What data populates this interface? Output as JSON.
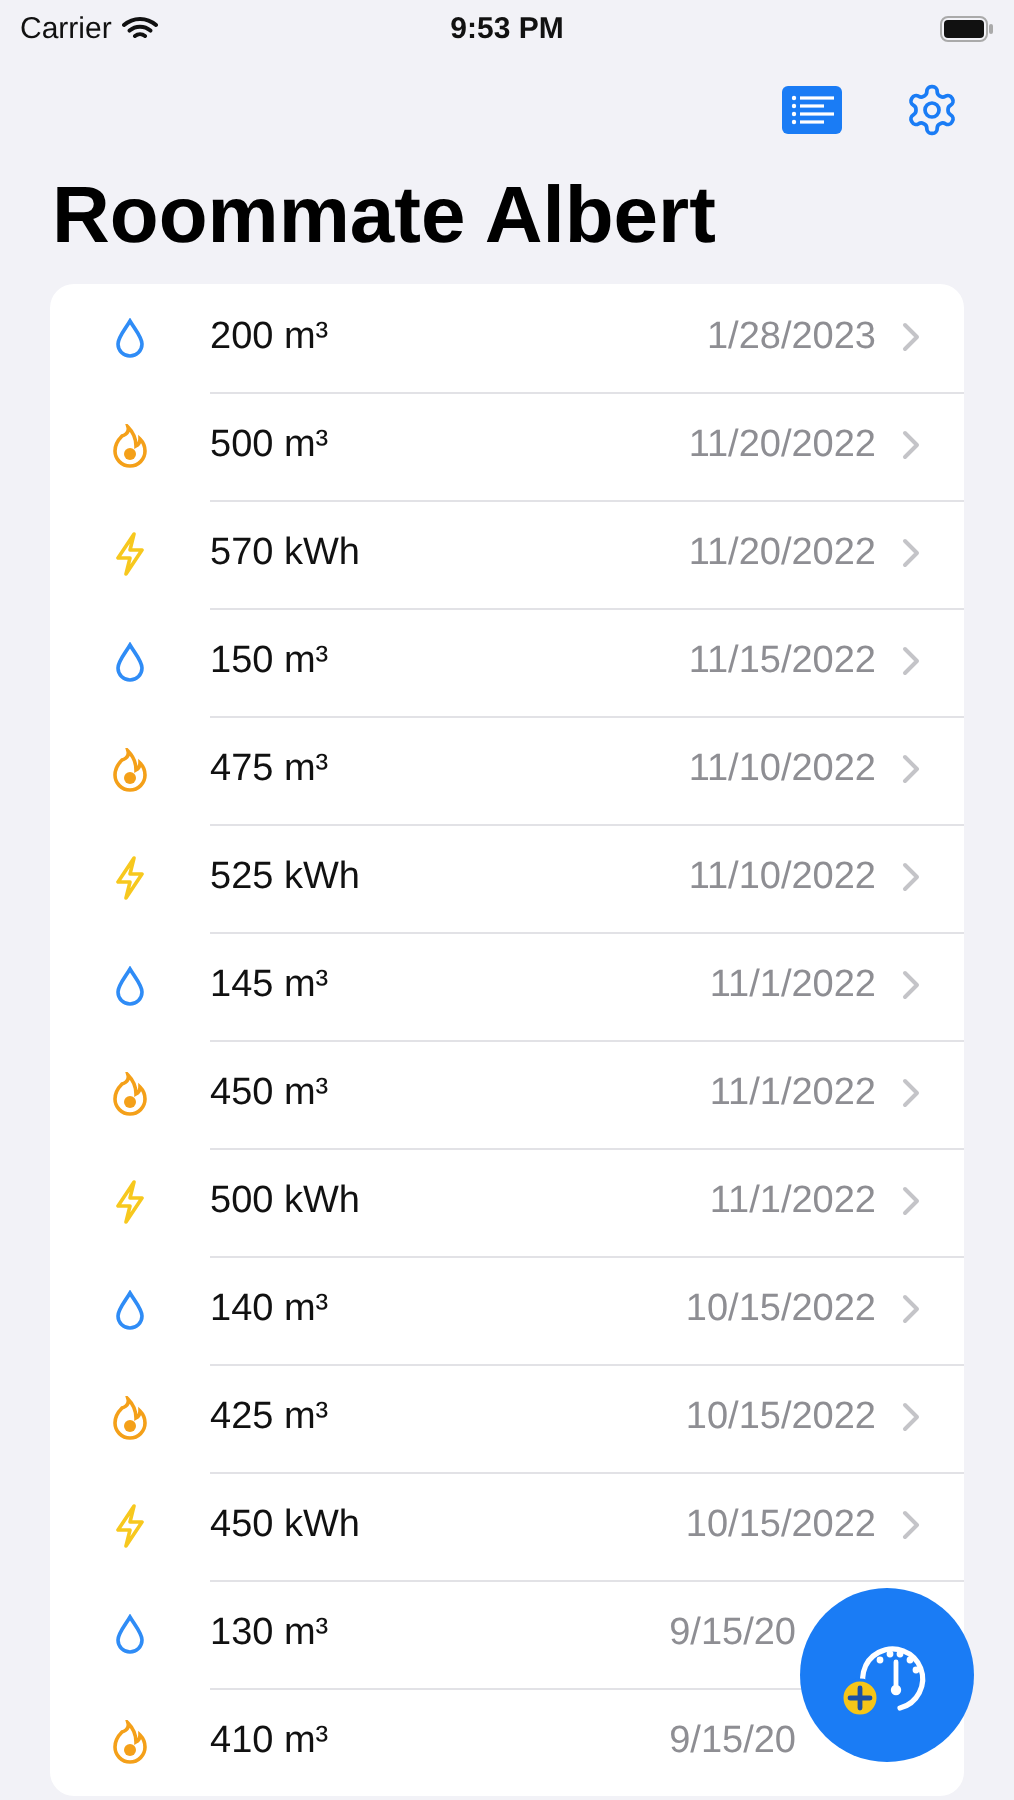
{
  "status_bar": {
    "carrier": "Carrier",
    "time": "9:53 PM"
  },
  "nav": {
    "title": "Roommate Albert"
  },
  "readings": [
    {
      "kind": "water",
      "value": "200 m³",
      "date": "1/28/2023",
      "chevron": true
    },
    {
      "kind": "gas",
      "value": "500 m³",
      "date": "11/20/2022",
      "chevron": true
    },
    {
      "kind": "power",
      "value": "570 kWh",
      "date": "11/20/2022",
      "chevron": true
    },
    {
      "kind": "water",
      "value": "150 m³",
      "date": "11/15/2022",
      "chevron": true
    },
    {
      "kind": "gas",
      "value": "475 m³",
      "date": "11/10/2022",
      "chevron": true
    },
    {
      "kind": "power",
      "value": "525 kWh",
      "date": "11/10/2022",
      "chevron": true
    },
    {
      "kind": "water",
      "value": "145 m³",
      "date": "11/1/2022",
      "chevron": true
    },
    {
      "kind": "gas",
      "value": "450 m³",
      "date": "11/1/2022",
      "chevron": true
    },
    {
      "kind": "power",
      "value": "500 kWh",
      "date": "11/1/2022",
      "chevron": true
    },
    {
      "kind": "water",
      "value": "140 m³",
      "date": "10/15/2022",
      "chevron": true
    },
    {
      "kind": "gas",
      "value": "425 m³",
      "date": "10/15/2022",
      "chevron": true
    },
    {
      "kind": "power",
      "value": "450 kWh",
      "date": "10/15/2022",
      "chevron": true
    },
    {
      "kind": "water",
      "value": "130 m³",
      "date": "9/15/20",
      "chevron": false
    },
    {
      "kind": "gas",
      "value": "410 m³",
      "date": "9/15/20",
      "chevron": false
    }
  ]
}
